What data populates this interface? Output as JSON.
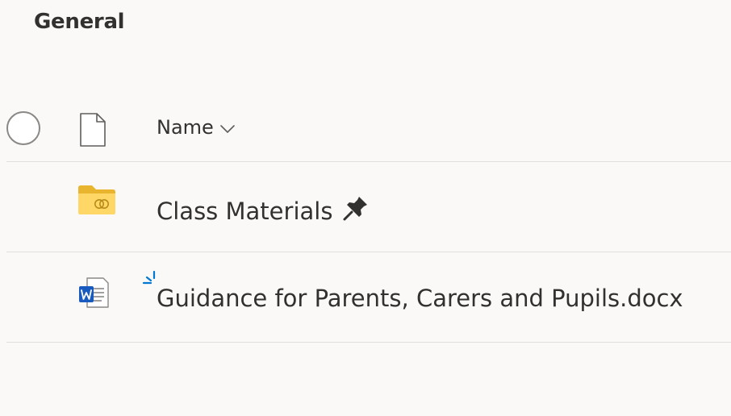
{
  "section": {
    "title": "General"
  },
  "list": {
    "header": {
      "name_label": "Name",
      "select_all_icon": "circle-icon",
      "type_icon": "document-icon",
      "sort_icon": "chevron-down-icon"
    },
    "rows": [
      {
        "name": "Class Materials",
        "type": "folder",
        "icon": "shared-folder-icon",
        "status_icon": "pin-icon"
      },
      {
        "name": "Guidance for Parents, Carers and Pupils.docx",
        "type": "word-document",
        "icon": "word-document-icon",
        "status_icon": "new-item-icon"
      }
    ]
  },
  "colors": {
    "background": "#faf9f8",
    "text": "#323130",
    "divider": "#e1dfdd",
    "folder": "#ffd766",
    "word_blue": "#185abd",
    "accent": "#0078d4"
  }
}
